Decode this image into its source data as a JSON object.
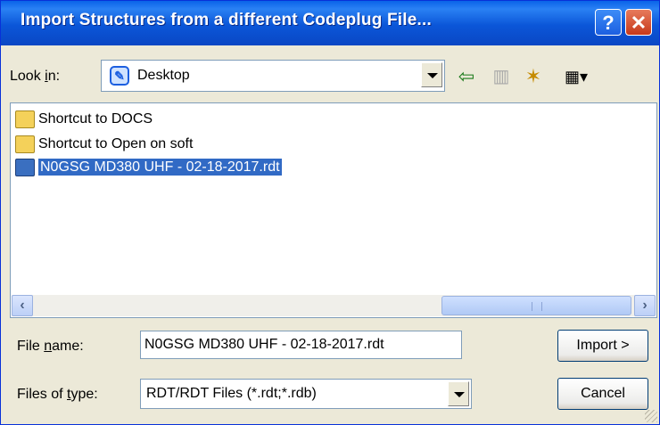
{
  "window": {
    "title": "Import Structures from a different Codeplug File..."
  },
  "titlebar": {
    "help_label": "?",
    "close_label": "✕"
  },
  "lookin": {
    "label_pre": "Look ",
    "label_key": "i",
    "label_post": "n:",
    "value": "Desktop"
  },
  "toolbar": {
    "back_glyph": "⇦",
    "up_glyph": "▥",
    "newfolder_glyph": "✶",
    "views_glyph": "▦▾"
  },
  "files": [
    {
      "label": "Shortcut to DOCS",
      "icon": "folder-shortcut-icon"
    },
    {
      "label": "Shortcut to Open on soft",
      "icon": "folder-shortcut-icon"
    },
    {
      "label": "N0GSG MD380 UHF - 02-18-2017.rdt",
      "icon": "rdt-file-icon",
      "selected": true
    }
  ],
  "scrollbar": {
    "left_glyph": "‹",
    "right_glyph": "›"
  },
  "filename": {
    "label_pre": "File ",
    "label_key": "n",
    "label_post": "ame:",
    "value": "N0GSG MD380 UHF - 02-18-2017.rdt"
  },
  "filetype": {
    "label_pre": "Files of ",
    "label_key": "t",
    "label_post": "ype:",
    "value": "RDT/RDT Files (*.rdt;*.rdb)"
  },
  "buttons": {
    "import": "Import >",
    "cancel": "Cancel"
  },
  "colors": {
    "titlebar": "#0a5ae0",
    "selection": "#316ac5",
    "dialog_bg": "#ece9d8"
  }
}
